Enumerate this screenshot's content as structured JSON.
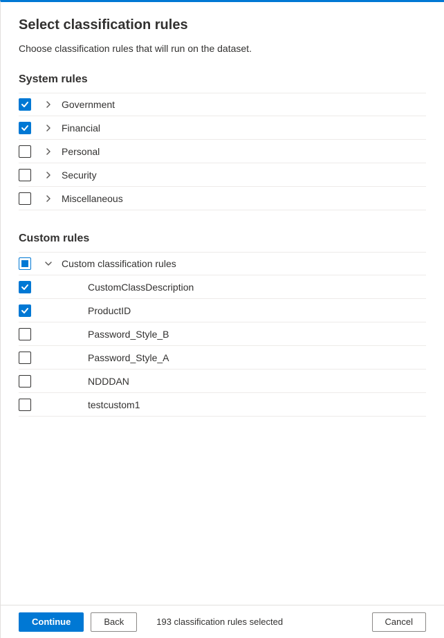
{
  "title": "Select classification rules",
  "description": "Choose classification rules that will run on the dataset.",
  "sections": {
    "system": {
      "heading": "System rules",
      "items": [
        {
          "label": "Government",
          "checked": true,
          "expandable": true,
          "expanded": false
        },
        {
          "label": "Financial",
          "checked": true,
          "expandable": true,
          "expanded": false
        },
        {
          "label": "Personal",
          "checked": false,
          "expandable": true,
          "expanded": false
        },
        {
          "label": "Security",
          "checked": false,
          "expandable": true,
          "expanded": false
        },
        {
          "label": "Miscellaneous",
          "checked": false,
          "expandable": true,
          "expanded": false
        }
      ]
    },
    "custom": {
      "heading": "Custom rules",
      "group": {
        "label": "Custom classification rules",
        "state": "mixed",
        "expanded": true
      },
      "items": [
        {
          "label": "CustomClassDescription",
          "checked": true
        },
        {
          "label": "ProductID",
          "checked": true
        },
        {
          "label": "Password_Style_B",
          "checked": false
        },
        {
          "label": "Password_Style_A",
          "checked": false
        },
        {
          "label": "NDDDAN",
          "checked": false
        },
        {
          "label": "testcustom1",
          "checked": false
        }
      ]
    }
  },
  "footer": {
    "continue": "Continue",
    "back": "Back",
    "cancel": "Cancel",
    "status": "193 classification rules selected"
  }
}
